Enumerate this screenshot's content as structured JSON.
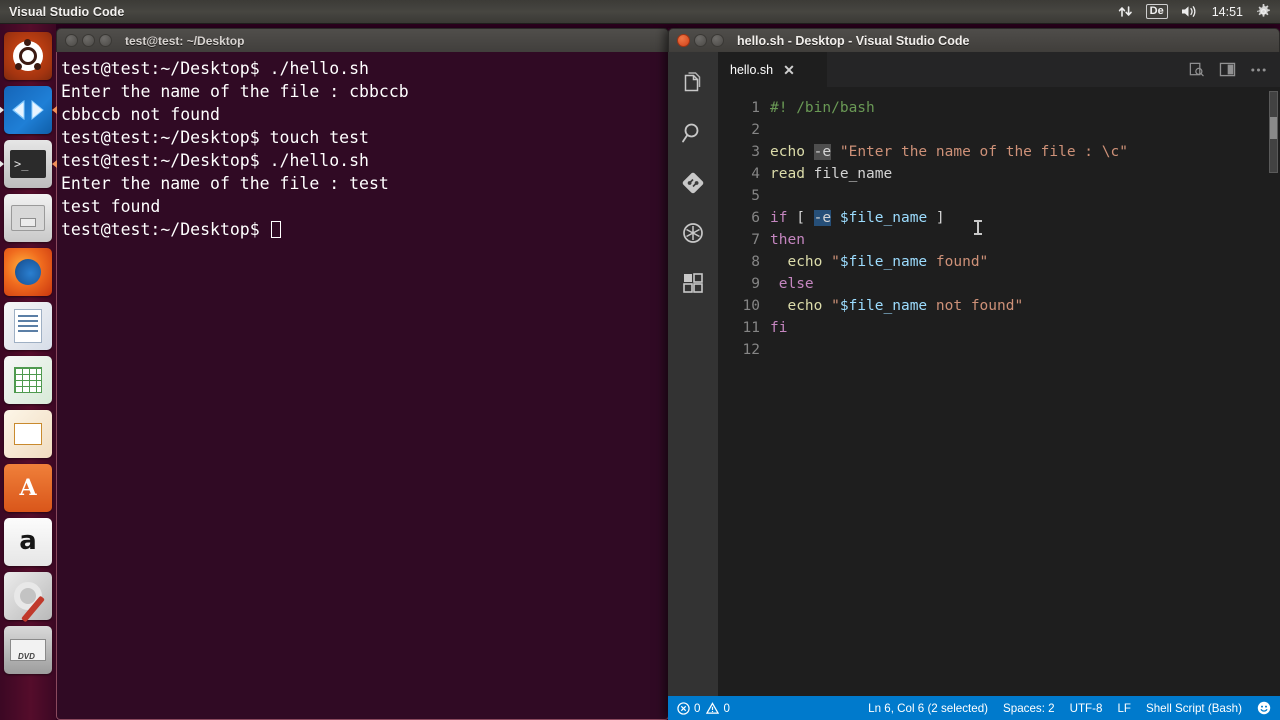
{
  "top_panel": {
    "app_title": "Visual Studio Code",
    "indicators": {
      "network_icon": "network-up-down-icon",
      "keyboard_layout": "De",
      "volume_icon": "volume-icon",
      "clock": "14:51",
      "gear_icon": "gear-icon"
    }
  },
  "launcher": {
    "items": [
      {
        "name": "ubuntu-dash",
        "label": "Ubuntu Dash"
      },
      {
        "name": "visual-studio-code",
        "label": "Visual Studio Code",
        "running": true
      },
      {
        "name": "terminal",
        "label": "Terminal",
        "running": true
      },
      {
        "name": "files",
        "label": "Files"
      },
      {
        "name": "firefox",
        "label": "Firefox"
      },
      {
        "name": "libreoffice-writer",
        "label": "LibreOffice Writer"
      },
      {
        "name": "libreoffice-calc",
        "label": "LibreOffice Calc"
      },
      {
        "name": "libreoffice-impress",
        "label": "LibreOffice Impress"
      },
      {
        "name": "ubuntu-software",
        "label": "Ubuntu Software"
      },
      {
        "name": "amazon",
        "label": "Amazon"
      },
      {
        "name": "system-settings",
        "label": "System Settings"
      },
      {
        "name": "dvd-drive",
        "label": "DVD Drive"
      }
    ]
  },
  "terminal": {
    "title": "test@test: ~/Desktop",
    "lines": [
      "test@test:~/Desktop$ ./hello.sh",
      "Enter the name of the file : cbbccb",
      "cbbccb not found",
      "test@test:~/Desktop$ touch test",
      "test@test:~/Desktop$ ./hello.sh",
      "Enter the name of the file : test",
      "test found"
    ],
    "prompt": "test@test:~/Desktop$ "
  },
  "vscode": {
    "window_title": "hello.sh - Desktop - Visual Studio Code",
    "activity_bar": [
      {
        "name": "explorer-icon",
        "label": "Explorer"
      },
      {
        "name": "search-icon",
        "label": "Search"
      },
      {
        "name": "source-control-icon",
        "label": "Source Control"
      },
      {
        "name": "debug-icon",
        "label": "Debug"
      },
      {
        "name": "extensions-icon",
        "label": "Extensions"
      }
    ],
    "tabs": [
      {
        "label": "hello.sh",
        "close": "✕",
        "active": true
      }
    ],
    "tab_actions": [
      {
        "name": "open-preview-icon"
      },
      {
        "name": "split-editor-icon"
      },
      {
        "name": "more-actions-icon",
        "label": "…"
      }
    ],
    "editor": {
      "line_numbers": [
        "1",
        "2",
        "3",
        "4",
        "5",
        "6",
        "7",
        "8",
        "9",
        "10",
        "11",
        "12"
      ],
      "code": {
        "l1_comment": "#! /bin/bash",
        "l3_echo": "echo",
        "l3_flag": "-e",
        "l3_string": "\"Enter the name of the file : \\c\"",
        "l4_read": "read",
        "l4_var": "file_name",
        "l6_if": "if",
        "l6_br_open": "[",
        "l6_flag": "-e",
        "l6_var": "$file_name",
        "l6_br_close": "]",
        "l7_then": "then",
        "l8_echo": "echo",
        "l8_string_open": "\"",
        "l8_var": "$file_name",
        "l8_string_rest": " found\"",
        "l9_else": "else",
        "l10_echo": "echo",
        "l10_string_open": "\"",
        "l10_var": "$file_name",
        "l10_string_rest": " not found\"",
        "l11_fi": "fi"
      }
    },
    "status_bar": {
      "errors": "0",
      "warnings": "0",
      "cursor_position": "Ln 6, Col 6 (2 selected)",
      "indentation": "Spaces: 2",
      "encoding": "UTF-8",
      "eol": "LF",
      "language": "Shell Script (Bash)",
      "feedback_icon": "smiley-icon"
    }
  },
  "colors": {
    "status_bar_bg": "#007acc",
    "editor_bg": "#1e1e1e",
    "activity_bar_bg": "#333333",
    "tab_bar_bg": "#252526",
    "terminal_bg": "#300a24",
    "selection_blue": "#264f78",
    "match_gray": "#4e4e4e"
  }
}
